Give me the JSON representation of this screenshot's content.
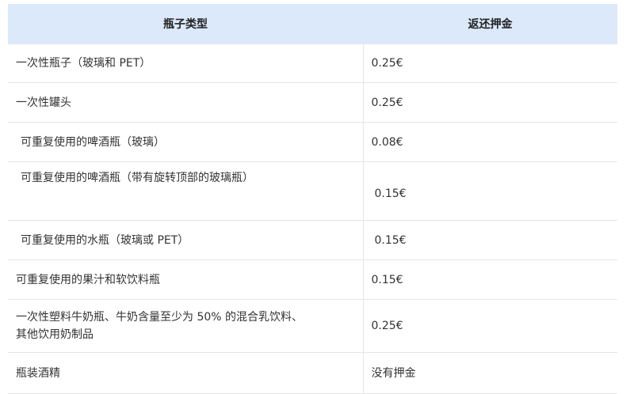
{
  "table": {
    "headers": {
      "type": "瓶子类型",
      "refund": "返还押金"
    },
    "rows": [
      {
        "type": "一次性瓶子（玻璃和 PET）",
        "refund": "0.25€"
      },
      {
        "type": "一次性罐头",
        "refund": "0.25€"
      },
      {
        "type": "可重复使用的啤酒瓶（玻璃）",
        "refund": "0.08€"
      },
      {
        "type": "可重复使用的啤酒瓶（带有旋转顶部的玻璃瓶）",
        "refund": "0.15€"
      },
      {
        "type": "可重复使用的水瓶（玻璃或 PET）",
        "refund": "0.15€"
      },
      {
        "type": "可重复使用的果汁和软饮料瓶",
        "refund": "0.15€"
      },
      {
        "type_line1": "一次性塑料牛奶瓶、牛奶含量至少为 50% 的混合乳饮料、",
        "type_line2": "其他饮用奶制品",
        "refund": "0.25€"
      },
      {
        "type": "瓶装酒精",
        "refund": "没有押金"
      }
    ]
  }
}
